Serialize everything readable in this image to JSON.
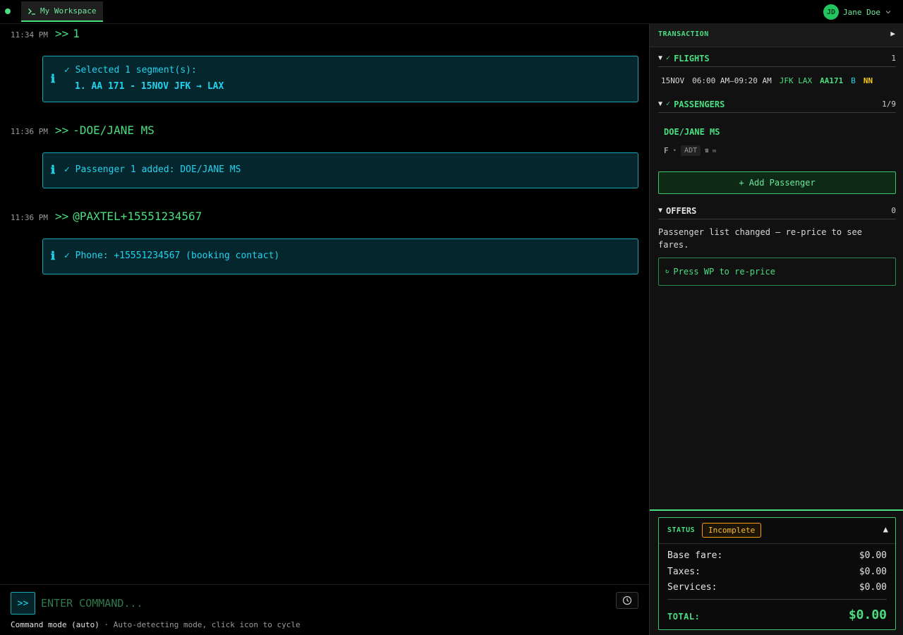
{
  "topbar": {
    "tab_label": "My Workspace",
    "user_initials": "JD",
    "user_name": "Jane Doe"
  },
  "console": {
    "entries": [
      {
        "time": "11:34 PM",
        "prompt": ">>",
        "command": "1",
        "messages": [
          "✓ Selected 1 segment(s):",
          "1. AA 171 - 15NOV JFK → LAX"
        ]
      },
      {
        "time": "11:36 PM",
        "prompt": ">>",
        "command": "-DOE/JANE MS",
        "messages": [
          "✓ Passenger 1 added: DOE/JANE MS"
        ]
      },
      {
        "time": "11:36 PM",
        "prompt": ">>",
        "command": "@PAXTEL+15551234567",
        "messages": [
          "✓ Phone: +15551234567 (booking contact)"
        ]
      }
    ],
    "info_icon": "ℹ"
  },
  "command_bar": {
    "button_label": ">>",
    "input_placeholder": "ENTER COMMAND...",
    "input_value": "",
    "mode_name": "Command mode (auto)",
    "mode_hint": "· Auto-detecting mode, click icon to cycle"
  },
  "panel": {
    "title": "TRANSACTION",
    "collapse_glyph": "▶",
    "flights": {
      "label": "FLIGHTS",
      "count": "1",
      "rows": [
        {
          "date": "15NOV",
          "time": "06:00 AM–09:20 AM",
          "route": "JFK LAX",
          "flight": "AA171",
          "class": "B",
          "status": "NN"
        }
      ]
    },
    "passengers": {
      "label": "PASSENGERS",
      "count": "1/9",
      "items": [
        {
          "name": "DOE/JANE MS",
          "gender": "F",
          "type": "ADT",
          "icons": "☎ ✉"
        }
      ],
      "add_label": "+ Add Passenger"
    },
    "offers": {
      "label": "OFFERS",
      "count": "0",
      "message": "Passenger list changed — re-price to see fares.",
      "reprice_label": "Press WP to re-price",
      "reprice_icon": "↻"
    },
    "status": {
      "label": "STATUS",
      "badge": "Incomplete",
      "toggle_glyph": "▲",
      "lines": [
        {
          "label": "Base fare:",
          "value": "$0.00"
        },
        {
          "label": "Taxes:",
          "value": "$0.00"
        },
        {
          "label": "Services:",
          "value": "$0.00"
        }
      ],
      "total_label": "TOTAL:",
      "total_value": "$0.00"
    }
  },
  "colors": {
    "accent_green": "#4ade80",
    "info_cyan": "#22d3ee",
    "warning_amber": "#fbbf24"
  }
}
